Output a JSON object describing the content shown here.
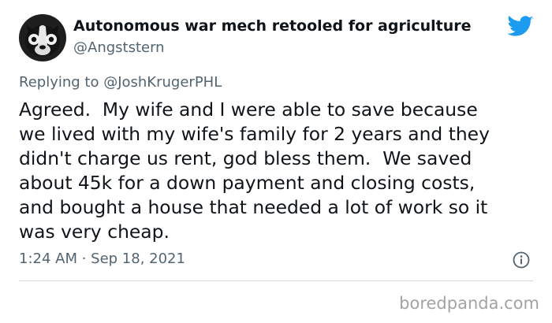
{
  "tweet": {
    "display_name": "Autonomous war mech retooled for agriculture",
    "handle": "@Angststern",
    "reply_prefix": "Replying to ",
    "reply_to": "@JoshKrugerPHL",
    "body": "Agreed.  My wife and I were able to save because\nwe lived with my wife's family for 2 years and they\ndidn't charge us rent, god bless them.  We saved\nabout 45k for a down payment and closing costs,\nand bought a house that needed a lot of work so it\nwas very cheap.",
    "timestamp": "1:24 AM · Sep 18, 2021",
    "icons": {
      "avatar": "boston-terrier-avatar",
      "brand": "twitter-bird-icon",
      "info": "info-icon"
    }
  },
  "footer": {
    "credit": "boredpanda.com"
  },
  "colors": {
    "text": "#0f1419",
    "secondary": "#536471",
    "twitter_blue": "#1d9bf0",
    "divider": "#cfd9de",
    "credit": "#a3a3a3"
  }
}
